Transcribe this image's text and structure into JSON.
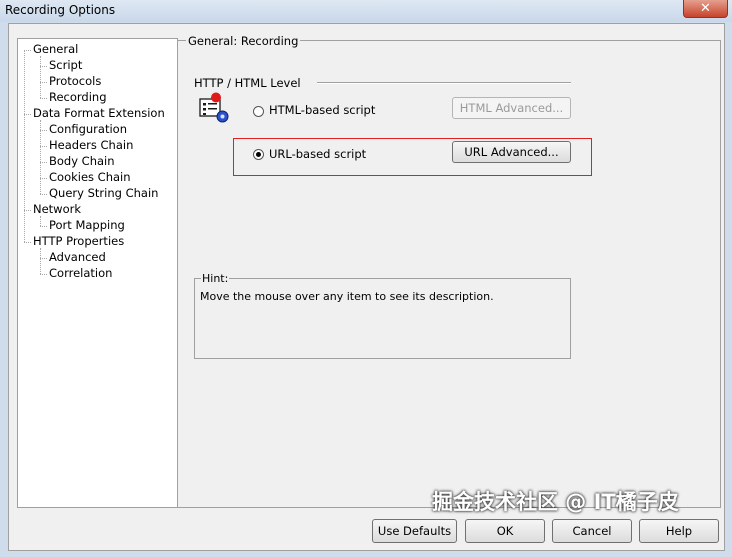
{
  "window": {
    "title": "Recording Options",
    "close_glyph": "✕"
  },
  "tree": {
    "items": [
      {
        "label": "General",
        "level": 0
      },
      {
        "label": "Script",
        "level": 1
      },
      {
        "label": "Protocols",
        "level": 1
      },
      {
        "label": "Recording",
        "level": 1
      },
      {
        "label": "Data Format Extension",
        "level": 0
      },
      {
        "label": "Configuration",
        "level": 1
      },
      {
        "label": "Headers Chain",
        "level": 1
      },
      {
        "label": "Body Chain",
        "level": 1
      },
      {
        "label": "Cookies Chain",
        "level": 1
      },
      {
        "label": "Query String Chain",
        "level": 1
      },
      {
        "label": "Network",
        "level": 0
      },
      {
        "label": "Port Mapping",
        "level": 1
      },
      {
        "label": "HTTP Properties",
        "level": 0
      },
      {
        "label": "Advanced",
        "level": 1
      },
      {
        "label": "Correlation",
        "level": 1
      }
    ]
  },
  "panel": {
    "title": "General: Recording",
    "level_label": "HTTP / HTML Level",
    "html_option": {
      "label": "HTML-based script",
      "selected": false,
      "button": "HTML Advanced...",
      "button_enabled": false
    },
    "url_option": {
      "label": "URL-based script",
      "selected": true,
      "button": "URL Advanced...",
      "button_enabled": true
    },
    "hint_label": "Hint:",
    "hint_text": "Move the mouse over any item to see its description."
  },
  "buttons": {
    "use_defaults": "Use Defaults",
    "ok": "OK",
    "cancel": "Cancel",
    "help": "Help"
  },
  "watermark": "掘金技术社区 @ IT橘子皮",
  "colors": {
    "highlight_box": "#e02020",
    "title_bar": "#cfdcec",
    "close_button": "#c7432b"
  }
}
